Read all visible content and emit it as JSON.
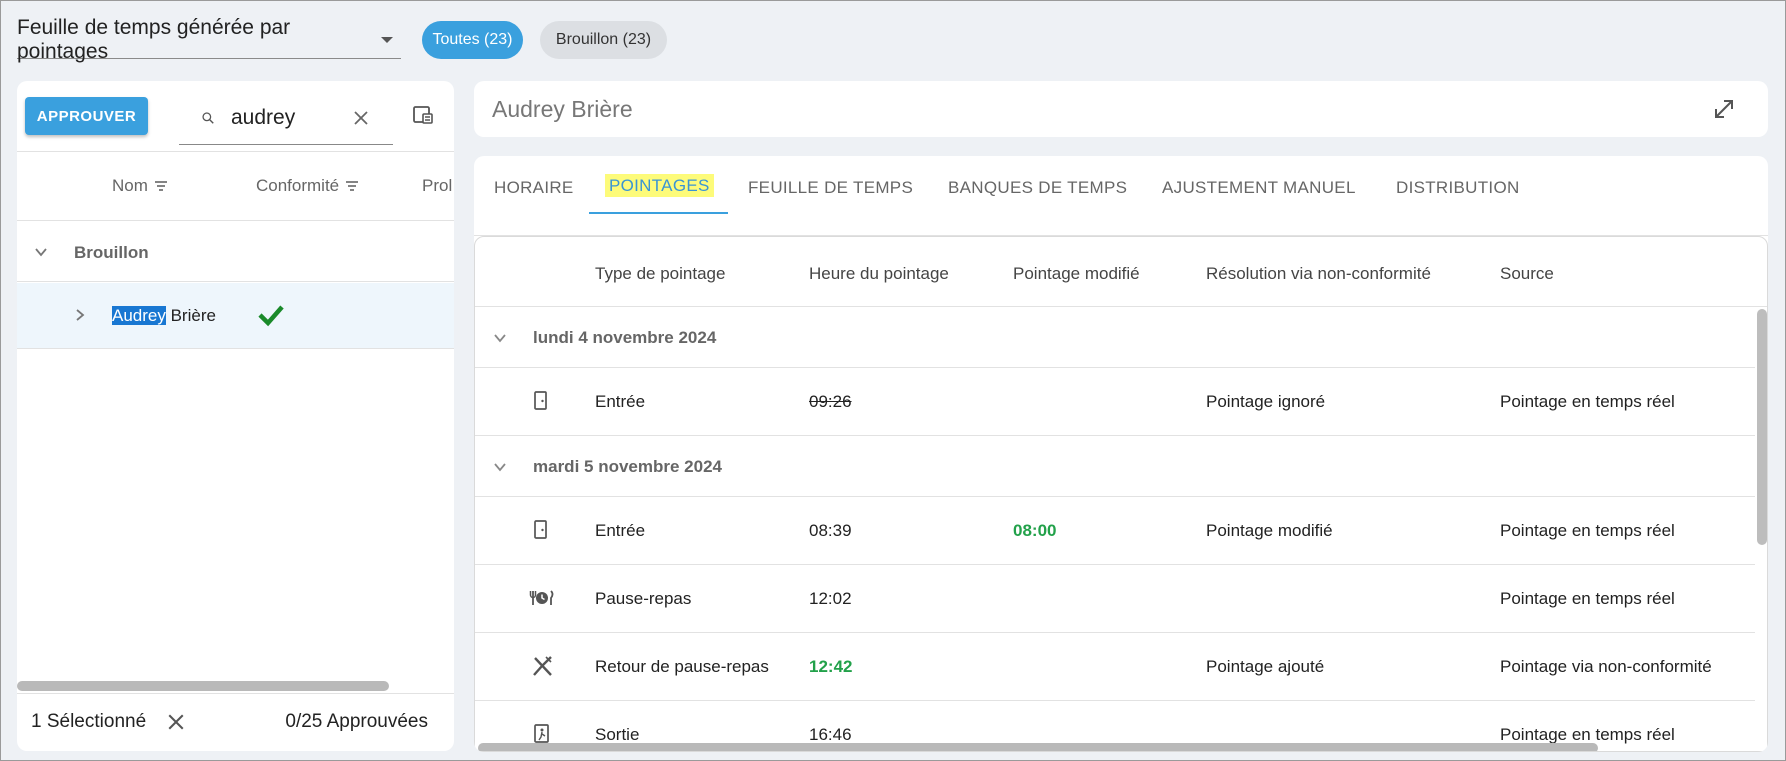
{
  "view_select": {
    "label": "Feuille de temps générée par pointages"
  },
  "chips": {
    "all": "Toutes (23)",
    "draft": "Brouillon (23)"
  },
  "left": {
    "approve_label": "APPROUVER",
    "search_value": "audrey",
    "columns": {
      "name": "Nom",
      "conformity": "Conformité",
      "third": "Prol"
    },
    "group_label": "Brouillon",
    "person": {
      "highlight": "Audrey",
      "rest": " Brière"
    },
    "footer": {
      "selected": "1 Sélectionné",
      "approved": "0/25 Approuvées"
    }
  },
  "title": "Audrey Brière",
  "tabs": [
    "HORAIRE",
    "POINTAGES",
    "FEUILLE DE TEMPS",
    "BANQUES DE TEMPS",
    "AJUSTEMENT MANUEL",
    "DISTRIBUTION"
  ],
  "table": {
    "headers": [
      "Type de pointage",
      "Heure du pointage",
      "Pointage modifié",
      "Résolution via non-conformité",
      "Source"
    ],
    "dates": [
      "lundi 4 novembre 2024",
      "mardi 5 novembre 2024"
    ],
    "rows": [
      {
        "icon": "door-entry-icon",
        "type": "Entrée",
        "time": "09:26",
        "modified": "",
        "resolution": "Pointage ignoré",
        "source": "Pointage en temps réel"
      },
      {
        "icon": "door-entry-icon",
        "type": "Entrée",
        "time": "08:39",
        "modified": "08:00",
        "resolution": "Pointage modifié",
        "source": "Pointage en temps réel"
      },
      {
        "icon": "meal-clock-icon",
        "type": "Pause-repas",
        "time": "12:02",
        "modified": "",
        "resolution": "",
        "source": "Pointage en temps réel"
      },
      {
        "icon": "utensils-crossed-icon",
        "type": "Retour de pause-repas",
        "time": "12:42",
        "modified": "",
        "resolution": "Pointage ajouté",
        "source": "Pointage via non-conformité"
      },
      {
        "icon": "exit-icon",
        "type": "Sortie",
        "time": "16:46",
        "modified": "",
        "resolution": "",
        "source": "Pointage en temps réel"
      }
    ]
  },
  "colors": {
    "accent": "#3aa0de",
    "green": "#22a14a",
    "highlight": "#fdfb7a"
  }
}
